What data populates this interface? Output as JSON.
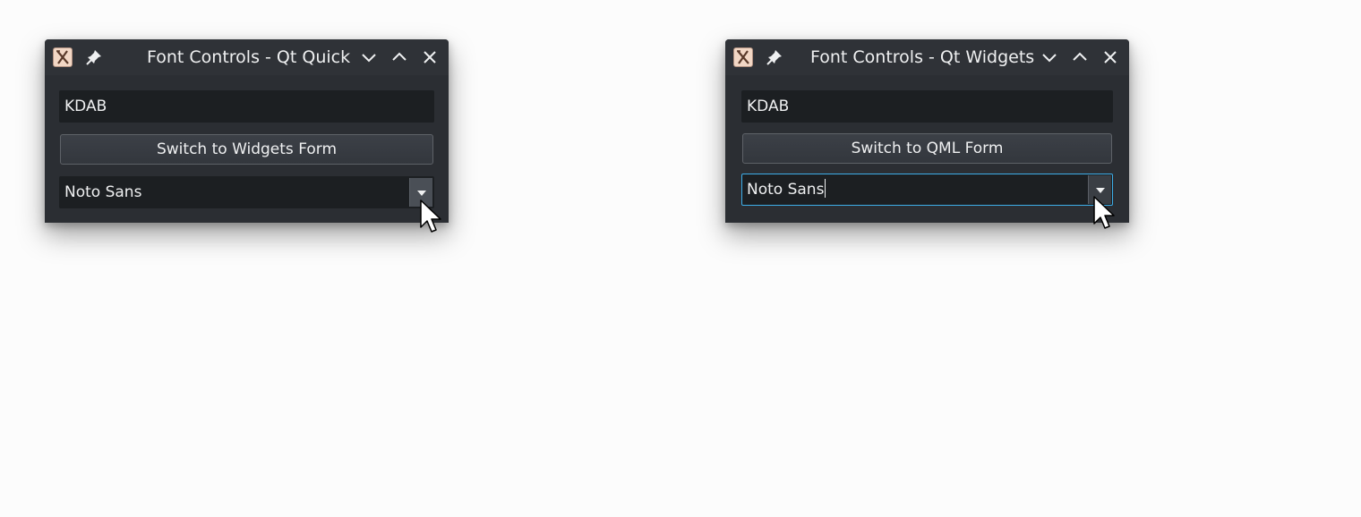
{
  "colors": {
    "window_bg": "#2b2e33",
    "input_bg": "#1c1f22",
    "focus_border": "#3daee9",
    "text": "#eff0f1"
  },
  "windows": [
    {
      "title": "Font Controls - Qt Quick",
      "icons": [
        "x-app-icon",
        "pin-icon",
        "minimize-icon",
        "maximize-icon",
        "close-icon"
      ],
      "line_edit_value": "KDAB",
      "button_label": "Switch to Widgets Form",
      "combo_value": "Noto Sans",
      "combo_focused": false
    },
    {
      "title": "Font Controls - Qt Widgets",
      "icons": [
        "x-app-icon",
        "pin-icon",
        "minimize-icon",
        "maximize-icon",
        "close-icon"
      ],
      "line_edit_value": "KDAB",
      "button_label": "Switch to QML Form",
      "combo_value": "Noto Sans",
      "combo_focused": true
    }
  ]
}
